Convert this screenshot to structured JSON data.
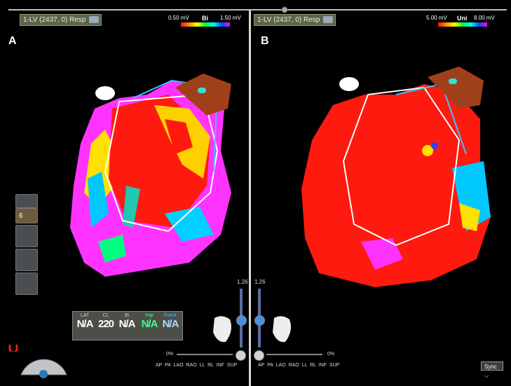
{
  "left_panel": {
    "tag": "A",
    "map_selector": "1-LV (2437, 0) Resp",
    "scale": {
      "min": "0.50 mV",
      "type": "Bi",
      "max": "1.50 mV"
    },
    "info": {
      "labels": [
        "LAT",
        "CL",
        "Bi",
        "Imp",
        "Force"
      ],
      "values": [
        "N/A",
        "220",
        "N/A",
        "N/A",
        "N/A"
      ]
    },
    "sidebar_value": "6",
    "zoom": "1.26",
    "percent": "0%"
  },
  "right_panel": {
    "tag": "B",
    "map_selector": "1-LV (2437, 0) Resp",
    "scale": {
      "min": "5.00 mV",
      "type": "Uni",
      "max": "8.00 mV"
    },
    "zoom": "1.26",
    "percent": "0%"
  },
  "views": "AP PA LAO RAO LL RL INF SUP",
  "sync": "Sync",
  "colors": {
    "red": "#ff1a10",
    "magenta": "#ff33ff",
    "cyan": "#22e0e0",
    "olive": "#5b6448"
  }
}
